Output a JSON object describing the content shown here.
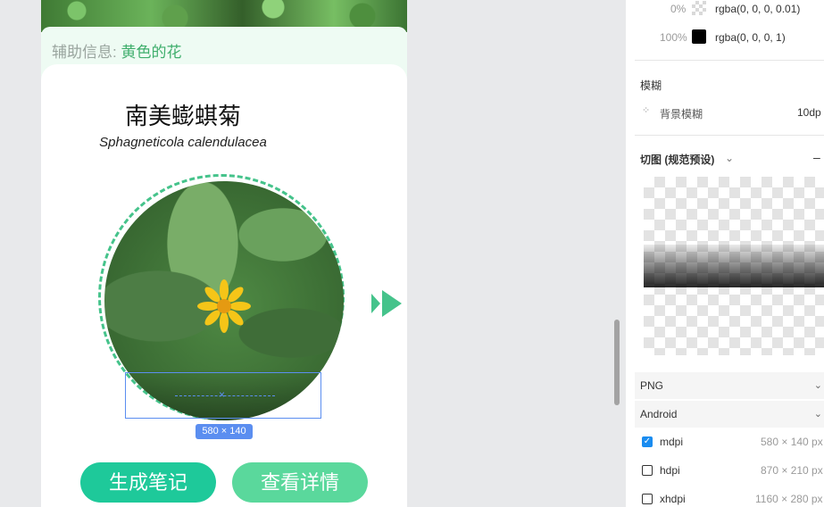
{
  "preview": {
    "hint_prefix": "辅助信息:",
    "hint_value": "黄色的花",
    "cn_name": "南美蟛蜞菊",
    "latin_name": "Sphagneticola calendulacea",
    "selection_size": "580 × 140",
    "btn_note": "生成笔记",
    "btn_detail": "查看详情"
  },
  "panel": {
    "gradient_stops": [
      {
        "pos": "0%",
        "value": "rgba(0, 0, 0, 0.01)"
      },
      {
        "pos": "100%",
        "value": "rgba(0, 0, 0, 1)"
      }
    ],
    "blur_section_title": "模糊",
    "blur_label": "背景模糊",
    "blur_value": "10dp",
    "slice_title": "切图 (规范预设)",
    "format": "PNG",
    "platform": "Android",
    "densities": [
      {
        "name": "mdpi",
        "size": "580 × 140 px",
        "checked": true
      },
      {
        "name": "hdpi",
        "size": "870 × 210 px",
        "checked": false
      },
      {
        "name": "xhdpi",
        "size": "1160 × 280 px",
        "checked": false
      }
    ]
  },
  "colors": {
    "accent_green": "#1ec99a",
    "selection_blue": "#5b8ef0",
    "checkbox_blue": "#1a8cf0"
  }
}
